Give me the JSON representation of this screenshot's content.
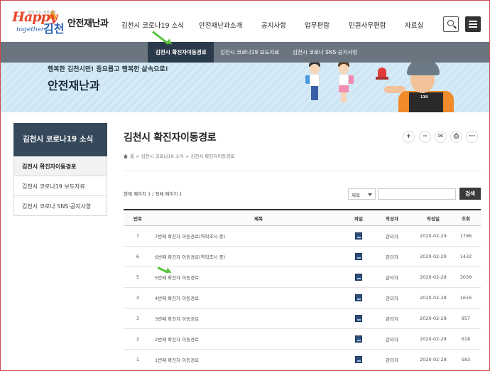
{
  "header": {
    "logo": {
      "happy": "Happy",
      "together": "together",
      "city": "김천",
      "tagline": "함께 하는 행복김천"
    },
    "dept_title": "안전재난과",
    "nav": [
      "김천시 코로나19 소식",
      "안전재난과소개",
      "공지사항",
      "업무편람",
      "민원사무편람",
      "자료실"
    ]
  },
  "subnav": {
    "items": [
      "김천시 확진자이동경로",
      "김천시 코로나19 보도자료",
      "김천시 코로나 SNS·공지사항"
    ],
    "active_index": 0
  },
  "banner": {
    "slogan": "행복한 김천시민! 풍요롭고 행복한 삶속으로!",
    "title": "안전재난과",
    "vest_text": "119"
  },
  "sidebar": {
    "title": "김천시 코로나19 소식",
    "items": [
      "김천시 확진자이동경로",
      "김천시 코로나19 보도자료",
      "김천시 코로나 SNS·공지사항"
    ],
    "active_index": 0
  },
  "content": {
    "page_title": "김천시 확진자이동경로",
    "breadcrumb": [
      "홈",
      "김천시 코로나19 소식",
      "김천시 확진자이동경로"
    ],
    "page_info": "현재 페이지 1 / 전체 페이지 1",
    "search": {
      "select_value": "제목",
      "input_value": "",
      "button": "검색"
    },
    "tools": [
      "+",
      "−",
      "✉",
      "⎙",
      "⋯"
    ]
  },
  "table": {
    "headers": [
      "번호",
      "제목",
      "파일",
      "작성자",
      "작성일",
      "조회"
    ],
    "rows": [
      {
        "num": "7",
        "title": "7번째 확진자 이동경로(역학조사 중)",
        "author": "관리자",
        "date": "2020-02-29",
        "views": "1796"
      },
      {
        "num": "6",
        "title": "6번째 확진자 이동경로(역학조사 중)",
        "author": "관리자",
        "date": "2020-02-29",
        "views": "1432"
      },
      {
        "num": "5",
        "title": "5번째 확진자 이동경로",
        "author": "관리자",
        "date": "2020-02-28",
        "views": "3039"
      },
      {
        "num": "4",
        "title": "4번째 확진자 이동경로",
        "author": "관리자",
        "date": "2020-02-28",
        "views": "1616"
      },
      {
        "num": "3",
        "title": "3번째 확진자 이동경로",
        "author": "관리자",
        "date": "2020-02-28",
        "views": "957"
      },
      {
        "num": "2",
        "title": "2번째 확진자 이동경로",
        "author": "관리자",
        "date": "2020-02-28",
        "views": "618"
      },
      {
        "num": "1",
        "title": "1번째 확진자 이동경로",
        "author": "관리자",
        "date": "2020-02-28",
        "views": "583"
      }
    ]
  },
  "colors": {
    "subnav_bg": "#6a7580",
    "subnav_active": "#2b3a4a",
    "sidebar_head": "#36495b",
    "banner_bg": "#cfe7f4",
    "annotation_arrow": "#58c23a",
    "frame_border": "#c9484a"
  }
}
